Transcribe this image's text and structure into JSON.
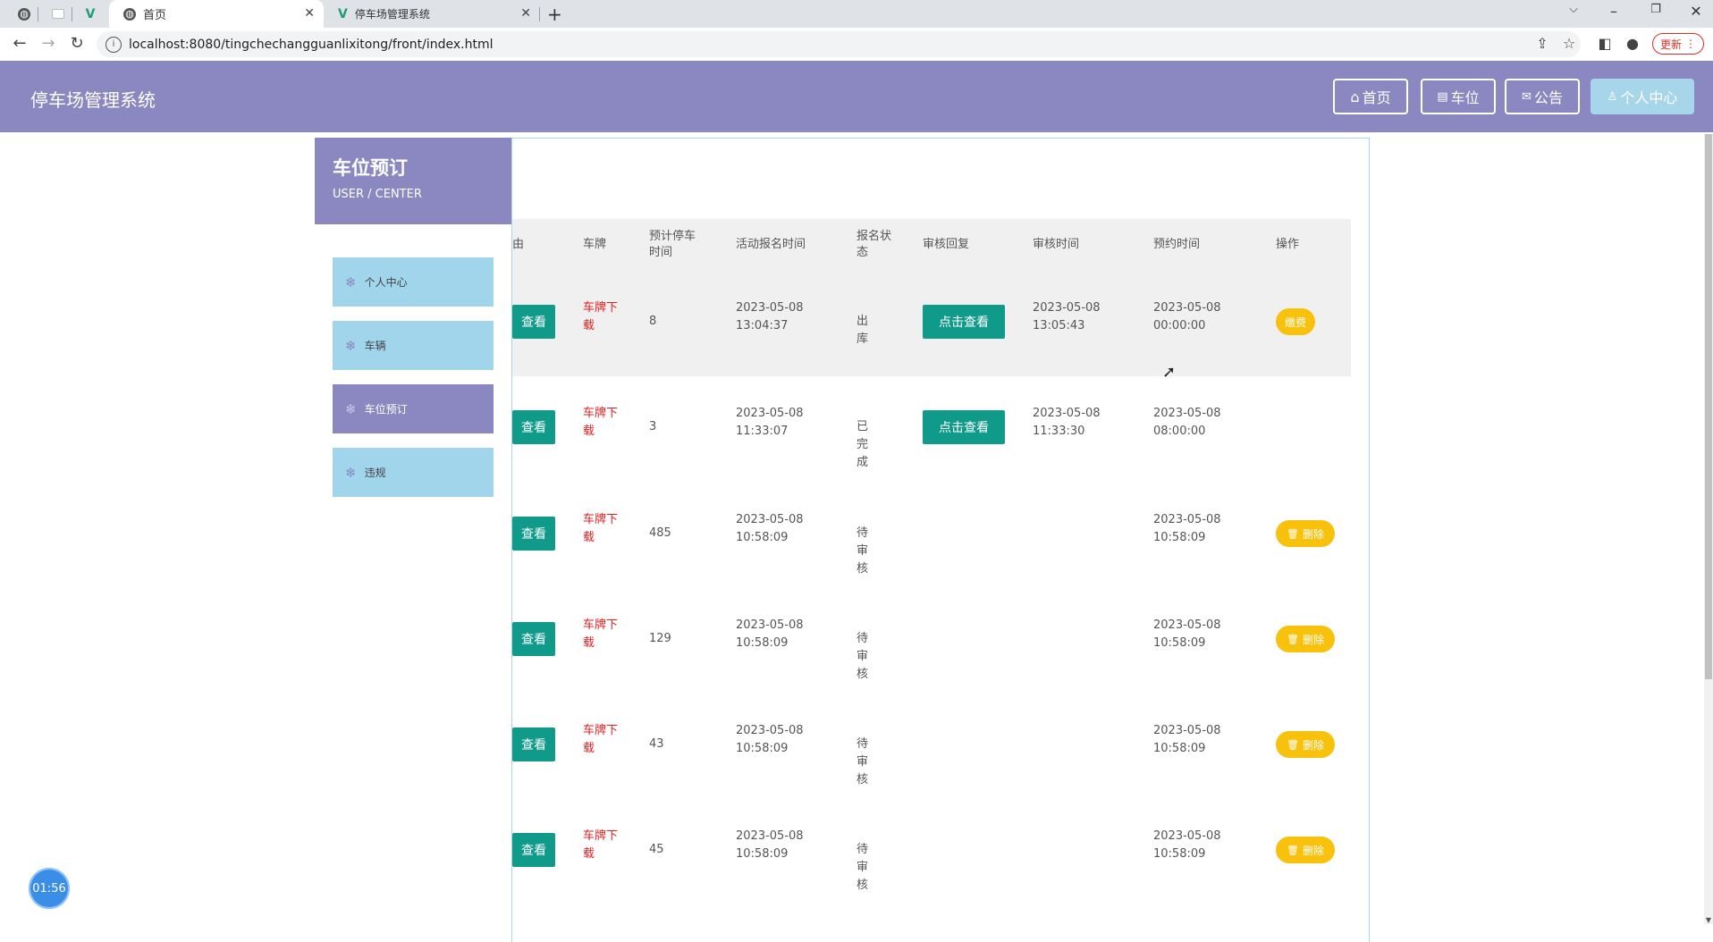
{
  "browser": {
    "tabs": [
      {
        "title": "首页",
        "active": true
      },
      {
        "title": "停车场管理系统",
        "active": false
      }
    ],
    "url": "localhost:8080/tingchechangguanlixitong/front/index.html",
    "update_label": "更新"
  },
  "header": {
    "title": "停车场管理系统",
    "nav": [
      {
        "label": "首页",
        "icon": "home-icon"
      },
      {
        "label": "车位",
        "icon": "gift-icon"
      },
      {
        "label": "公告",
        "icon": "mail-icon"
      },
      {
        "label": "个人中心",
        "icon": "user-icon",
        "active": true
      }
    ]
  },
  "sidebar": {
    "title": "车位预订",
    "subtitle": "USER / CENTER",
    "items": [
      {
        "label": "个人中心"
      },
      {
        "label": "车辆"
      },
      {
        "label": "车位预订",
        "active": true
      },
      {
        "label": "违规"
      }
    ]
  },
  "table": {
    "columns": [
      "由",
      "车牌",
      "预计停车时间",
      "活动报名时间",
      "报名状态",
      "审核回复",
      "审核时间",
      "预约时间",
      "操作"
    ],
    "rows": [
      {
        "view": "查看",
        "plate": "车牌下载",
        "hours": "8",
        "signup_time": "2023-05-08 13:04:37",
        "status": "出库",
        "reply": "点击查看",
        "review_time": "2023-05-08 13:05:43",
        "booking_time": "2023-05-08 00:00:00",
        "action": "缴费"
      },
      {
        "view": "查看",
        "plate": "车牌下载",
        "hours": "3",
        "signup_time": "2023-05-08 11:33:07",
        "status": "已完成",
        "reply": "点击查看",
        "review_time": "2023-05-08 11:33:30",
        "booking_time": "2023-05-08 08:00:00",
        "action": ""
      },
      {
        "view": "查看",
        "plate": "车牌下载",
        "hours": "485",
        "signup_time": "2023-05-08 10:58:09",
        "status": "待审核",
        "reply": "",
        "review_time": "",
        "booking_time": "2023-05-08 10:58:09",
        "action": "删除"
      },
      {
        "view": "查看",
        "plate": "车牌下载",
        "hours": "129",
        "signup_time": "2023-05-08 10:58:09",
        "status": "待审核",
        "reply": "",
        "review_time": "",
        "booking_time": "2023-05-08 10:58:09",
        "action": "删除"
      },
      {
        "view": "查看",
        "plate": "车牌下载",
        "hours": "43",
        "signup_time": "2023-05-08 10:58:09",
        "status": "待审核",
        "reply": "",
        "review_time": "",
        "booking_time": "2023-05-08 10:58:09",
        "action": "删除"
      },
      {
        "view": "查看",
        "plate": "车牌下载",
        "hours": "45",
        "signup_time": "2023-05-08 10:58:09",
        "status": "待审核",
        "reply": "",
        "review_time": "",
        "booking_time": "2023-05-08 10:58:09",
        "action": "删除"
      }
    ]
  },
  "timer": "01:56",
  "colors": {
    "primary": "#8b88c1",
    "accent": "#a7d6ea",
    "teal": "#0f9a8a",
    "warning": "#f8c10c",
    "plate_red": "#e02020"
  }
}
